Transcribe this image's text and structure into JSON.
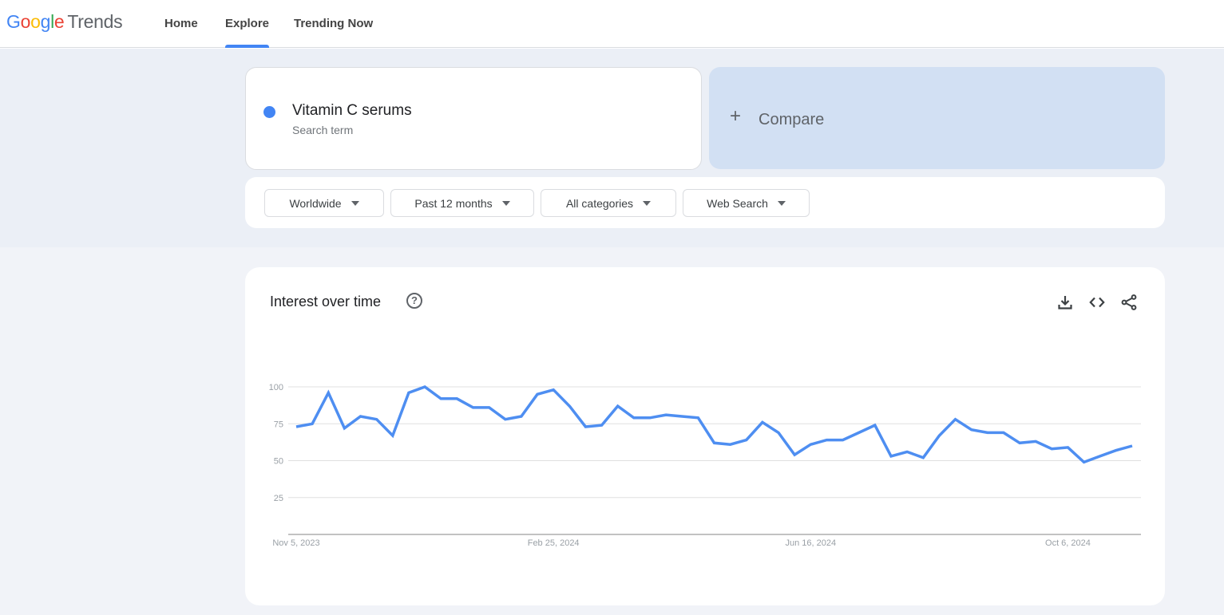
{
  "header": {
    "logo": {
      "google": "Google",
      "product": "Trends"
    },
    "nav": [
      {
        "label": "Home",
        "active": false
      },
      {
        "label": "Explore",
        "active": true
      },
      {
        "label": "Trending Now",
        "active": false
      }
    ],
    "accent_color": "#4285f4"
  },
  "search_terms": [
    {
      "term": "Vitamin C serums",
      "sublabel": "Search term",
      "color": "#4285f4"
    }
  ],
  "compare": {
    "icon": "plus-icon",
    "label": "Compare"
  },
  "filters": [
    {
      "label": "Worldwide",
      "icon": "caret-down-icon"
    },
    {
      "label": "Past 12 months",
      "icon": "caret-down-icon"
    },
    {
      "label": "All categories",
      "icon": "caret-down-icon"
    },
    {
      "label": "Web Search",
      "icon": "caret-down-icon"
    }
  ],
  "chart_card": {
    "title": "Interest over time",
    "help_icon": "help-icon",
    "help_glyph": "?",
    "actions": [
      {
        "name": "download-icon"
      },
      {
        "name": "embed-code-icon"
      },
      {
        "name": "share-icon"
      }
    ]
  },
  "chart_data": {
    "type": "line",
    "title": "Interest over time",
    "xlabel": "",
    "ylabel": "",
    "ylim": [
      0,
      100
    ],
    "yticks": [
      25,
      50,
      75,
      100
    ],
    "ytick_labels": [
      "25",
      "50",
      "75",
      "100"
    ],
    "xtick_labels": [
      "Nov 5, 2023",
      "Feb 25, 2024",
      "Jun 16, 2024",
      "Oct 6, 2024"
    ],
    "xtick_indices": [
      0,
      16,
      32,
      48
    ],
    "grid": true,
    "legend": "none",
    "series": [
      {
        "name": "Vitamin C serums",
        "color": "#4e8ef1",
        "values": [
          73,
          75,
          96,
          72,
          80,
          78,
          67,
          96,
          100,
          92,
          92,
          86,
          86,
          78,
          80,
          95,
          98,
          87,
          73,
          74,
          87,
          79,
          79,
          81,
          80,
          79,
          62,
          61,
          64,
          76,
          69,
          54,
          61,
          64,
          64,
          69,
          74,
          53,
          56,
          52,
          67,
          78,
          71,
          69,
          69,
          62,
          63,
          58,
          59,
          49,
          53,
          57,
          60
        ]
      }
    ]
  }
}
